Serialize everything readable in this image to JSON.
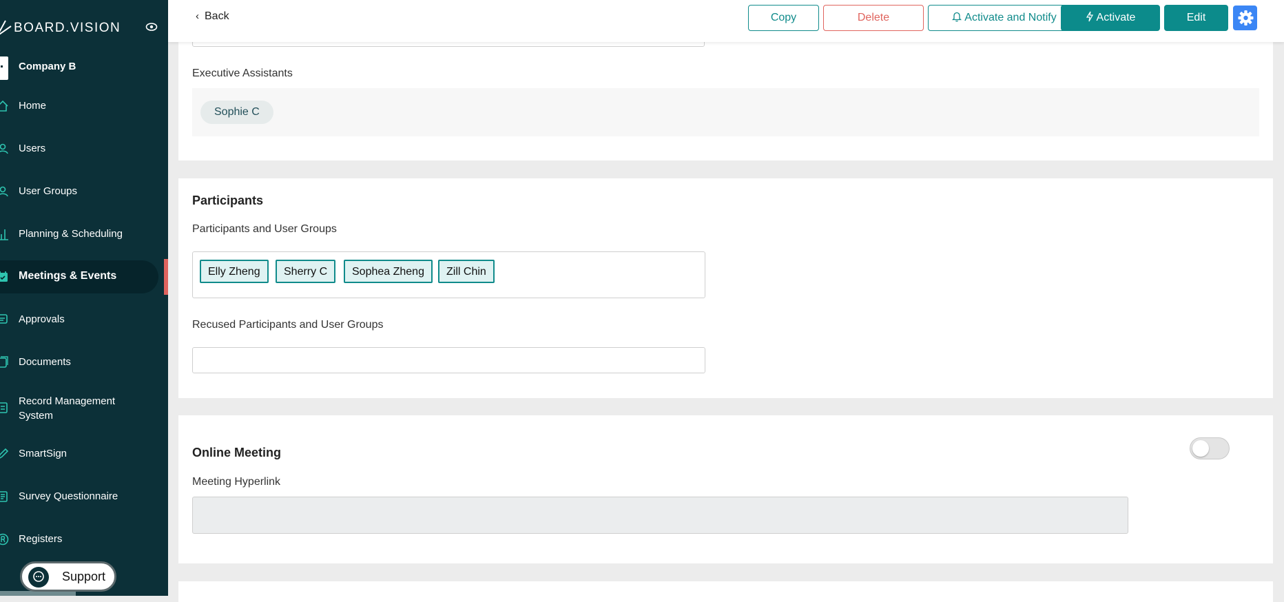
{
  "brand": {
    "name": "BOARD.VISION"
  },
  "company": {
    "name": "Company B"
  },
  "sidebar": {
    "items": [
      {
        "label": "Home",
        "icon": "home-icon"
      },
      {
        "label": "Users",
        "icon": "user-icon"
      },
      {
        "label": "User Groups",
        "icon": "user-group-icon"
      },
      {
        "label": "Planning & Scheduling",
        "icon": "chart-icon"
      },
      {
        "label": "Meetings & Events",
        "icon": "calendar-icon",
        "active": true
      },
      {
        "label": "Approvals",
        "icon": "approval-icon"
      },
      {
        "label": "Documents",
        "icon": "documents-icon"
      },
      {
        "label": "Record Management System",
        "icon": "record-icon"
      },
      {
        "label": "SmartSign",
        "icon": "pen-icon"
      },
      {
        "label": "Survey Questionnaire",
        "icon": "survey-icon"
      },
      {
        "label": "Registers",
        "icon": "registers-icon"
      }
    ],
    "support_label": "Support"
  },
  "toolbar": {
    "back_label": "Back",
    "copy_label": "Copy",
    "delete_label": "Delete",
    "activate_notify_label": "Activate and Notify",
    "activate_label": "Activate",
    "edit_label": "Edit"
  },
  "executive_assistants": {
    "label": "Executive Assistants",
    "people": [
      "Sophie C"
    ]
  },
  "participants": {
    "title": "Participants",
    "groups_label": "Participants and User Groups",
    "tags": [
      "Elly Zheng",
      "Sherry C",
      "Sophea Zheng",
      "Zill Chin"
    ],
    "recused_label": "Recused Participants and User Groups",
    "recused_value": ""
  },
  "online_meeting": {
    "title": "Online Meeting",
    "enabled": false,
    "hyperlink_label": "Meeting Hyperlink",
    "hyperlink_value": ""
  },
  "colors": {
    "sidebar_bg": "#0c3038",
    "accent_teal": "#0c8b8b",
    "danger": "#e0645e",
    "gear_blue": "#3b86f5"
  }
}
